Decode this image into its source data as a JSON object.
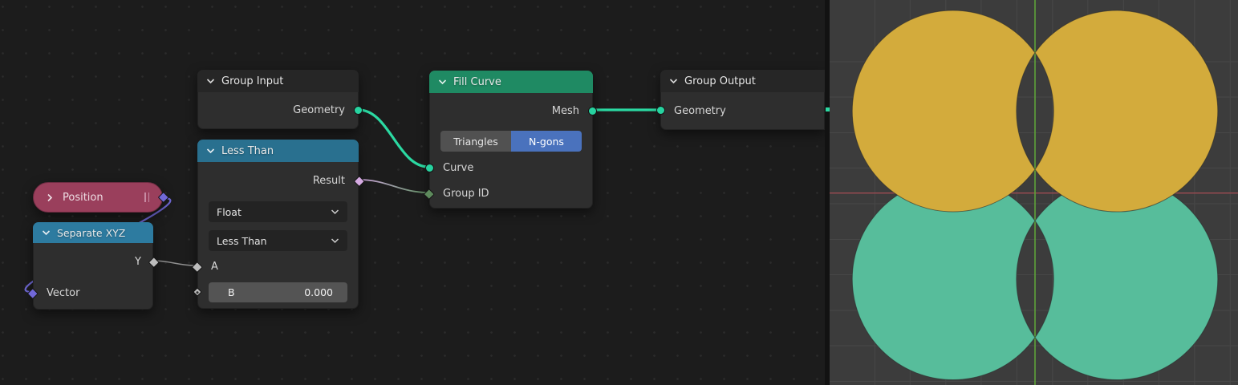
{
  "editor": {
    "nodes": {
      "group_input": {
        "title": "Group Input",
        "output_geometry": "Geometry"
      },
      "less_than": {
        "title": "Less Than",
        "output_result": "Result",
        "data_type": "Float",
        "operation": "Less Than",
        "input_a": "A",
        "input_b_label": "B",
        "input_b_value": "0.000"
      },
      "position": {
        "title": "Position"
      },
      "separate_xyz": {
        "title": "Separate XYZ",
        "output_y": "Y",
        "input_vector": "Vector"
      },
      "fill_curve": {
        "title": "Fill Curve",
        "output_mesh": "Mesh",
        "mode_triangles": "Triangles",
        "mode_ngons": "N-gons",
        "input_curve": "Curve",
        "input_group_id": "Group ID"
      },
      "group_output": {
        "title": "Group Output",
        "input_geometry": "Geometry"
      }
    }
  },
  "viewport": {
    "objects": "four filled circles (even-odd fill), two yellow top, two green bottom",
    "circle_colors": {
      "top": "#d3ab3c",
      "bottom": "#57bd9b"
    }
  },
  "colors": {
    "editor_background": "#1c1c1c",
    "node_body": "#2e2e2e",
    "io_header": "#262626",
    "converter_header": "#29708f",
    "input_node_pill": "#9a3f5c",
    "geometry_header": "#1f8a63",
    "active_button": "#4a72bd",
    "socket_geometry": "#27d3a0",
    "socket_boolean": "#d5aae2",
    "socket_float": "#bdbdbd",
    "socket_vector": "#7168d8",
    "socket_int": "#5d8a5c",
    "viewport_background": "#3c3c3c",
    "axis_x": "#9e4b52",
    "axis_y": "#5ea23a"
  }
}
